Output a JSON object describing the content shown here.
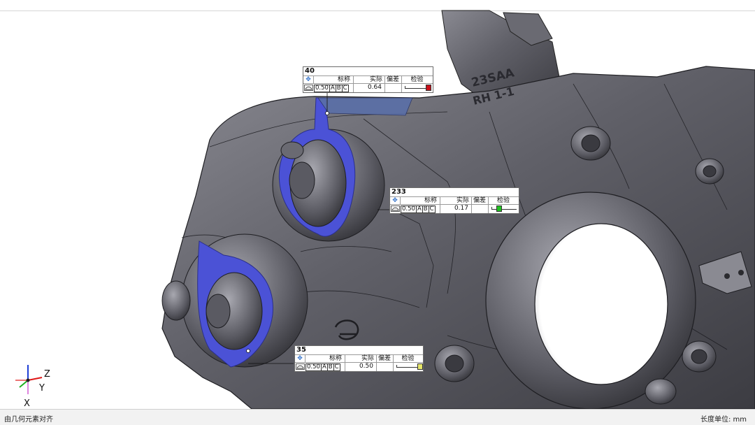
{
  "statusbar": {
    "left_text": "由几何元素对齐",
    "right_text": "长度单位: mm"
  },
  "part_markings": {
    "line1": "23SAA",
    "line2": "RH 1-1"
  },
  "colors": {
    "highlight": "#4b52d6",
    "part_dark": "#4a4a4f",
    "part_mid": "#707078",
    "part_light": "#9a9aa2",
    "marker_red": "#c8101a",
    "marker_green": "#21c221",
    "marker_yellow": "#e6e66a"
  },
  "triad": {
    "z": "Z",
    "y": "Y",
    "x": "X"
  },
  "callouts": [
    {
      "id": "40",
      "hdr_nominal": "标称",
      "hdr_actual": "实际",
      "hdr_deviation": "偏差",
      "hdr_check": "检验",
      "tolerance": "0.50",
      "datum_a": "A",
      "datum_b": "B",
      "datum_c": "C",
      "actual": "0.64",
      "deviation": "",
      "marker_color": "#c8101a",
      "marker_fraction": 1.0
    },
    {
      "id": "233",
      "hdr_nominal": "标称",
      "hdr_actual": "实际",
      "hdr_deviation": "偏差",
      "hdr_check": "检验",
      "tolerance": "0.50",
      "datum_a": "A",
      "datum_b": "B",
      "datum_c": "C",
      "actual": "0.17",
      "deviation": "",
      "marker_color": "#21c221",
      "marker_fraction": 0.34
    },
    {
      "id": "35",
      "hdr_nominal": "标称",
      "hdr_actual": "实际",
      "hdr_deviation": "偏差",
      "hdr_check": "检验",
      "tolerance": "0.50",
      "datum_a": "A",
      "datum_b": "B",
      "datum_c": "C",
      "actual": "0.50",
      "deviation": "",
      "marker_color": "#e6e66a",
      "marker_fraction": 1.0
    }
  ]
}
